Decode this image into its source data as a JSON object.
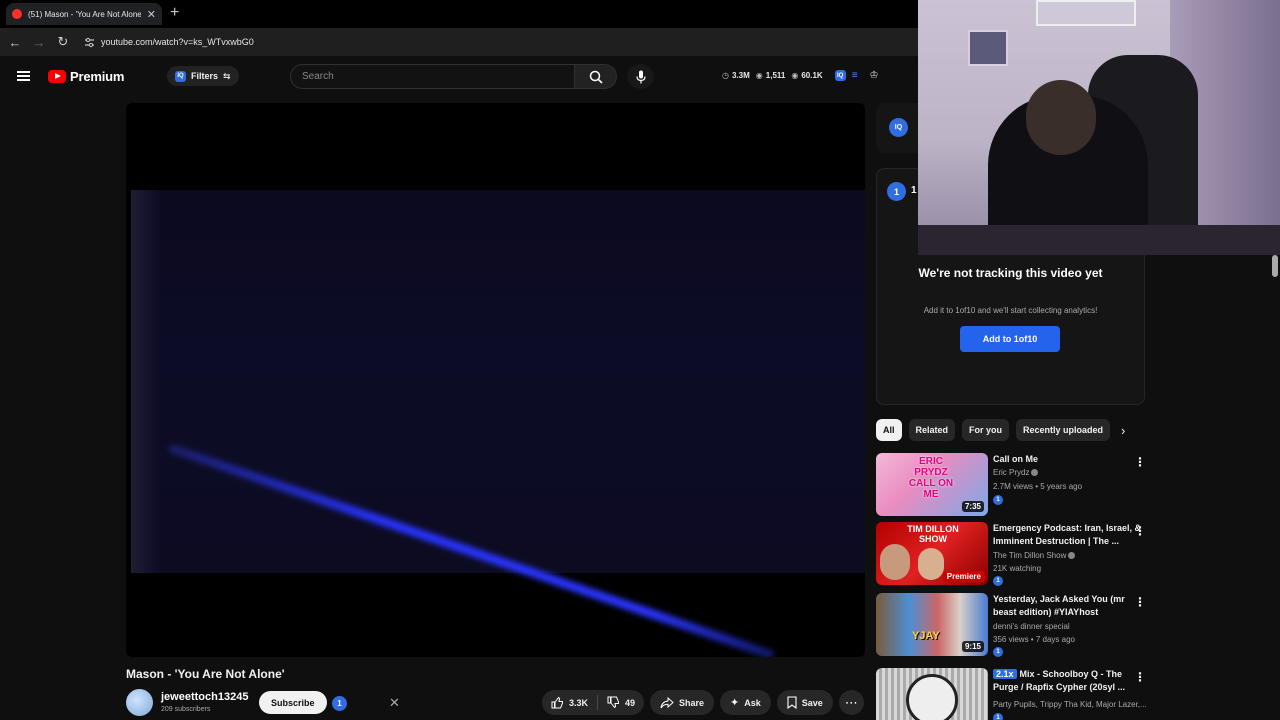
{
  "browser": {
    "tab_title": "(51) Mason - 'You Are Not Alone'",
    "tab_close": "✕",
    "new_tab": "+",
    "url": "youtube.com/watch?v=ks_WTvxwbG0"
  },
  "header": {
    "logo_word": "Premium",
    "filters_label": "Filters",
    "search_placeholder": "Search",
    "stats": [
      {
        "icon": "clock-icon",
        "value": "3.3M"
      },
      {
        "icon": "eye-icon",
        "value": "1,511"
      },
      {
        "icon": "eye-icon",
        "value": "60.1K"
      }
    ]
  },
  "video": {
    "title": "Mason - 'You Are Not Alone'",
    "channel": "jeweettoch13245",
    "subscribers": "209 subscribers",
    "subscribe_label": "Subscribe",
    "badge": "1",
    "likes": "3.3K",
    "dislikes": "49",
    "share_label": "Share",
    "ask_label": "Ask",
    "save_label": "Save"
  },
  "extension": {
    "iq_label": "IQ",
    "one_badge": "1",
    "one_label": "1",
    "not_tracking_title": "We're not tracking this video yet",
    "not_tracking_sub": "Add it to 1of10 and we'll start collecting analytics!",
    "add_button": "Add to 1of10",
    "accent_color": "#2463eb"
  },
  "chips": [
    "All",
    "Related",
    "For you",
    "Recently uploaded"
  ],
  "recommendations": [
    {
      "title": "Call on Me",
      "channel": "Eric Prydz",
      "verified": true,
      "meta": "2.7M views • 5 years ago",
      "duration": "7:35",
      "thumb_text": "ERIC PRYDZ CALL ON ME",
      "badge": "1"
    },
    {
      "title": "Emergency Podcast: Iran, Israel, & Imminent Destruction | The ...",
      "channel": "The Tim Dillon Show",
      "verified": true,
      "meta": "21K watching",
      "duration": "Premiere",
      "thumb_text": "TIM DILLON SHOW",
      "badge": "1"
    },
    {
      "title": "Yesterday, Jack Asked You (mr beast edition) #YIAYhost",
      "channel": "denni's dinner special",
      "verified": false,
      "meta": "356 views • 7 days ago",
      "duration": "9:15",
      "thumb_text": "YJAY",
      "badge": "1"
    },
    {
      "title": "Mix - Schoolboy Q - The Purge / Rapfix Cypher (20syl ...",
      "multiplier": "2.1x",
      "channel": "Party Pupils, Trippy Tha Kid, Major Lazer,...",
      "verified": false,
      "meta": "",
      "duration": "",
      "thumb_text": "",
      "badge": "1"
    }
  ]
}
